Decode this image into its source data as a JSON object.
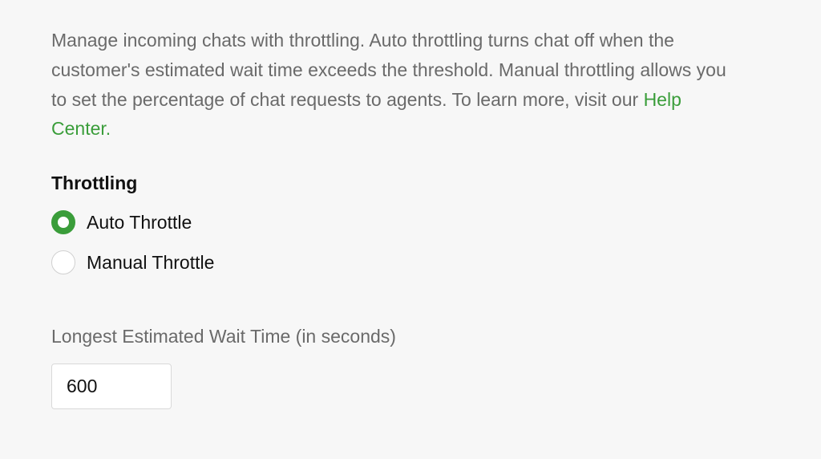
{
  "description": {
    "text_before_link": "Manage incoming chats with throttling. Auto throttling turns chat off when the customer's estimated wait time exceeds the threshold. Manual throttling allows you to set the percentage of chat requests to agents. To learn more, visit our ",
    "link_text": "Help Center.",
    "text_after_link": ""
  },
  "section_title": "Throttling",
  "radio_options": {
    "auto": "Auto Throttle",
    "manual": "Manual Throttle"
  },
  "wait_time": {
    "label": "Longest Estimated Wait Time (in seconds)",
    "value": "600"
  }
}
